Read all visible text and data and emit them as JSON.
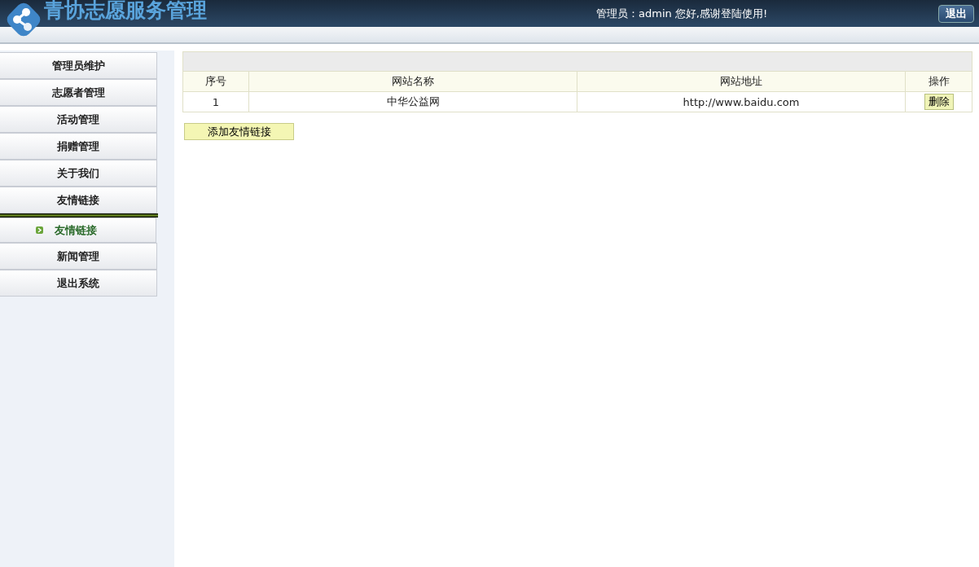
{
  "header": {
    "title": "青协志愿服务管理",
    "greeting": "管理员：admin 您好,感谢登陆使用!",
    "logout_button": "退出"
  },
  "sidebar": {
    "items": [
      {
        "label": "管理员维护",
        "selected": false
      },
      {
        "label": "志愿者管理",
        "selected": false
      },
      {
        "label": "活动管理",
        "selected": false
      },
      {
        "label": "捐赠管理",
        "selected": false
      },
      {
        "label": "关于我们",
        "selected": false
      },
      {
        "label": "友情链接",
        "selected": false
      },
      {
        "label": "友情链接",
        "selected": true
      },
      {
        "label": "新闻管理",
        "selected": false
      },
      {
        "label": "退出系统",
        "selected": false
      }
    ]
  },
  "table": {
    "columns": [
      "序号",
      "网站名称",
      "网站地址",
      "操作"
    ],
    "rows": [
      {
        "index": "1",
        "name": "中华公益网",
        "url": "http://www.baidu.com",
        "action": "删除"
      }
    ]
  },
  "add_button": "添加友情链接"
}
